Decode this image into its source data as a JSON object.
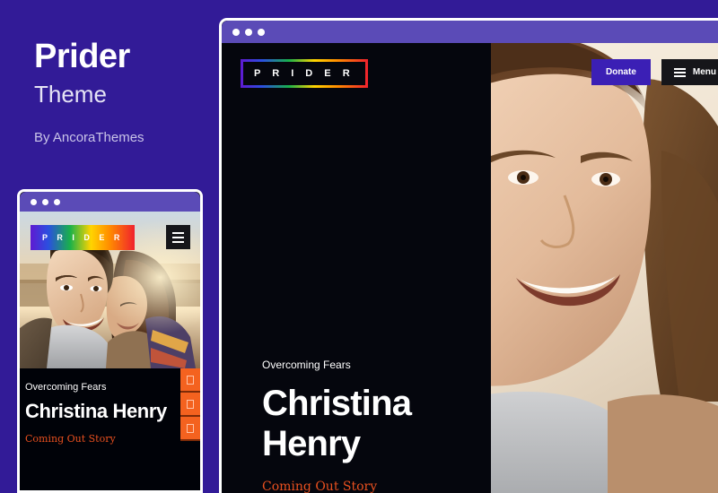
{
  "background_color": "#321b97",
  "intro": {
    "theme_name": "Prider",
    "theme_word": "Theme",
    "author_line": "By AncoraThemes"
  },
  "desktop_preview": {
    "chrome": {
      "dots": 3
    },
    "logo_text": "P R I D E R",
    "header": {
      "donate_label": "Donate",
      "menu_label": "Menu",
      "menu_icon": "hamburger-icon"
    },
    "hero": {
      "eyebrow": "Overcoming Fears",
      "headline": "Christina Henry",
      "tagline": "Coming Out Story"
    },
    "photo_alt": "close-up-smiling-couple-photo"
  },
  "mobile_preview": {
    "chrome": {
      "dots": 3
    },
    "logo_text": "P R I D E R",
    "menu_icon": "hamburger-icon",
    "share_buttons": [
      {
        "name": "share-facebook",
        "glyph": "square-icon"
      },
      {
        "name": "share-twitter",
        "glyph": "square-icon"
      },
      {
        "name": "share-pinterest",
        "glyph": "square-icon"
      }
    ],
    "corner_button": {
      "name": "share-extra",
      "glyph": "square-icon"
    },
    "hero": {
      "eyebrow": "Overcoming Fears",
      "headline": "Christina Henry",
      "tagline": "Coming Out Story"
    },
    "photo_alt": "couple-embracing-at-sunset-photo"
  },
  "colors": {
    "page_bg": "#321b97",
    "chrome_bar": "#5b4bb7",
    "dark_panel": "#05060d",
    "accent_orange": "#e8501f",
    "donate_purple": "#3b1fb5",
    "share_orange": "#f4621f"
  }
}
